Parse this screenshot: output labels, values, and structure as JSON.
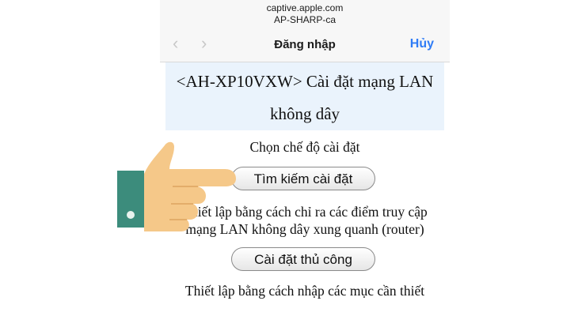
{
  "browser": {
    "url_host": "captive.apple.com",
    "network_name": "AP-SHARP-ca",
    "back_icon": "chevron-left-icon",
    "forward_icon": "chevron-right-icon",
    "title": "Đăng nhập",
    "cancel_label": "Hủy",
    "accent_color": "#2f7cf6"
  },
  "page": {
    "header_line1": "<AH-XP10VXW> Cài đặt mạng LAN",
    "header_line2": "không dây",
    "select_mode": "Chọn chế độ cài đặt",
    "search_button": "Tìm kiếm cài đặt",
    "search_desc_line1": "Thiết lập bằng cách chỉ ra các điểm truy cập",
    "search_desc_line2": "mạng LAN không dây xung quanh (router)",
    "manual_button": "Cài đặt thủ công",
    "manual_desc": "Thiết lập bằng cách nhập các mục cần thiết"
  },
  "overlay": {
    "icon": "pointing-hand-icon",
    "skin_color": "#f5c889",
    "sleeve_color": "#3c8c7c"
  }
}
